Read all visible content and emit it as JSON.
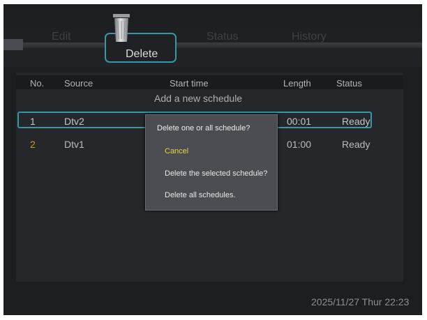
{
  "tabs": {
    "edit": "Edit",
    "delete": "Delete",
    "status": "Status",
    "history": "History"
  },
  "table": {
    "columns": [
      "No.",
      "Source",
      "Start time",
      "Length",
      "Status"
    ],
    "add_new": "Add a new schedule",
    "rows": [
      {
        "no": "1",
        "source": "Dtv2",
        "length": "00:01",
        "status": "Ready"
      },
      {
        "no": "2",
        "source": "Dtv1",
        "length": "01:00",
        "status": "Ready"
      }
    ]
  },
  "dialog": {
    "title": "Delete one or all schedule?",
    "options": [
      "Cancel",
      "Delete the selected schedule?",
      "Delete all schedules."
    ]
  },
  "footer": {
    "datetime": "2025/11/27 Thur 22:23"
  },
  "colors": {
    "accent": "#3a97a5",
    "highlight": "#e3d53c",
    "row_number": "#c99b29"
  },
  "icons": {
    "delete_tab": "trash-icon"
  }
}
